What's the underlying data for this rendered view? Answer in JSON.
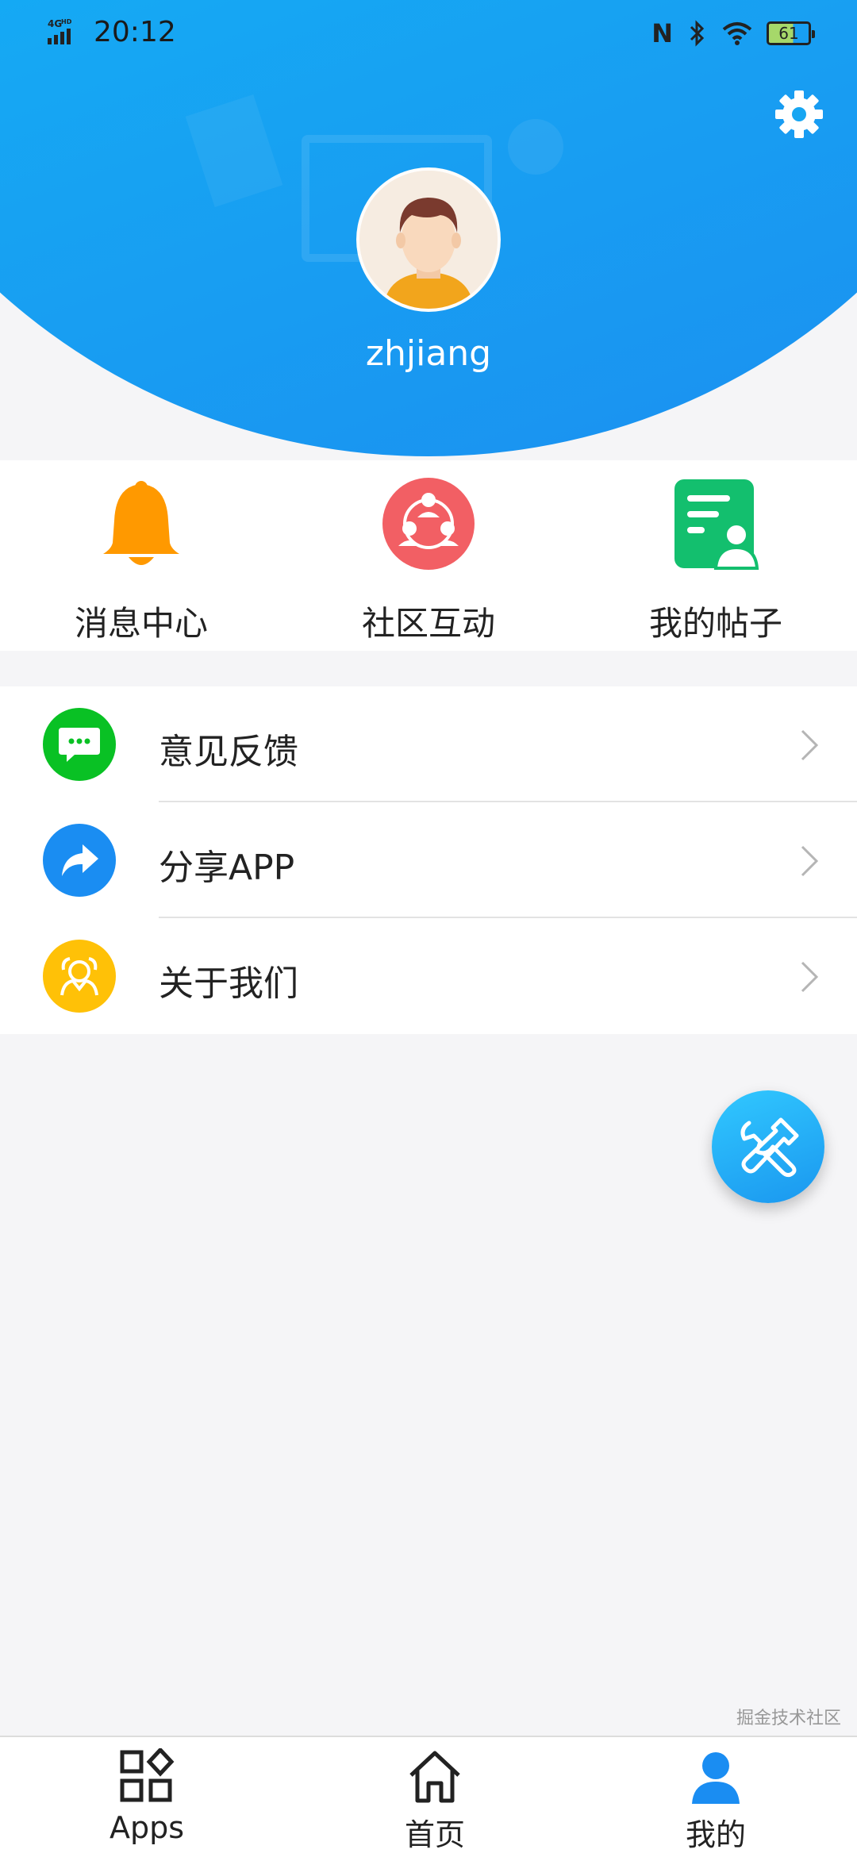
{
  "status_bar": {
    "network": "4G HD",
    "time": "20:12",
    "battery_level": "61",
    "icons": [
      "signal-icon",
      "nfc-icon",
      "bluetooth-icon",
      "wifi-icon",
      "battery-icon"
    ]
  },
  "header": {
    "username": "zhjiang",
    "settings_icon": "gear-icon",
    "gradient_colors": [
      "#00c2ff",
      "#1b8ef0"
    ]
  },
  "quick_actions": [
    {
      "label": "消息中心",
      "icon": "bell-icon",
      "color": "#ff9900"
    },
    {
      "label": "社区互动",
      "icon": "community-icon",
      "color": "#f25f64"
    },
    {
      "label": "我的帖子",
      "icon": "posts-icon",
      "color": "#13bf6e"
    }
  ],
  "menu": [
    {
      "label": "意见反馈",
      "icon": "chat-bubble-icon",
      "color": "#09c124"
    },
    {
      "label": "分享APP",
      "icon": "share-arrow-icon",
      "color": "#1a8df2"
    },
    {
      "label": "关于我们",
      "icon": "people-icon",
      "color": "#ffc107"
    }
  ],
  "fab": {
    "icon": "tools-icon",
    "color": "#1a97ef"
  },
  "tabbar": {
    "items": [
      {
        "label": "Apps",
        "icon": "apps-grid-icon",
        "active": false
      },
      {
        "label": "首页",
        "icon": "home-icon",
        "active": false
      },
      {
        "label": "我的",
        "icon": "person-icon",
        "active": true
      }
    ],
    "active_color": "#1a8df2"
  },
  "watermark": "掘金技术社区"
}
